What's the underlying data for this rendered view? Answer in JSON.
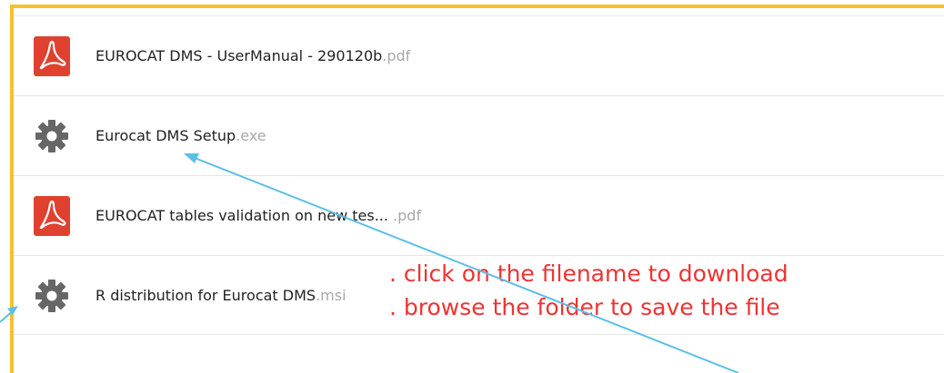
{
  "files": [
    {
      "name": "EUROCAT DMS - UserManual - 290120b",
      "ext": ".pdf",
      "icon": "pdf-icon"
    },
    {
      "name": "Eurocat DMS Setup",
      "ext": ".exe",
      "icon": "gear-icon"
    },
    {
      "name": "EUROCAT tables validation on new tes...",
      "ext": " .pdf",
      "icon": "pdf-icon"
    },
    {
      "name": "R distribution for Eurocat DMS",
      "ext": ".msi",
      "icon": "gear-icon"
    }
  ],
  "annotation": {
    "line1": ". click on the filename to download",
    "line2": ". browse the folder to save the file"
  },
  "colors": {
    "frame": "#f5c12e",
    "pdf_icon": "#e0412f",
    "gear_icon": "#666666",
    "annotation_text": "#ee3333",
    "arrow": "#5bbfe8"
  }
}
